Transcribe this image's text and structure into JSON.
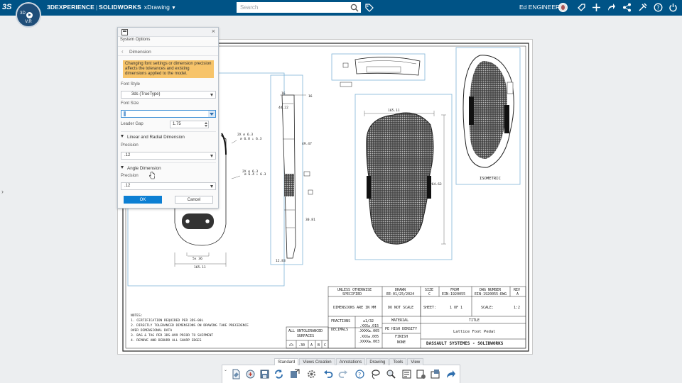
{
  "topbar": {
    "compass_quadrants": [
      "3D",
      "V.R"
    ],
    "logo": "3S",
    "brand_bold": "3DEXPERIENCE",
    "separator": "|",
    "brand_product": "SOLIDWORKS",
    "app_name": "xDrawing",
    "search_placeholder": "Search",
    "user_name": "Ed ENGINEER",
    "icons": [
      "compass-icon",
      "search-icon",
      "tag-icon",
      "avatar",
      "share-icon",
      "add-icon",
      "send-icon",
      "network-icon",
      "tools-icon",
      "help-icon",
      "power-icon"
    ]
  },
  "options_panel": {
    "title": "System Options",
    "section": "Dimension",
    "warning": "Changing font settings or dimension precision affects the tolerances and existing dimensions applied to the model.",
    "font_style_label": "Font Style",
    "font_style_value": "3ds (TrueType)",
    "font_size_label": "Font Size",
    "font_size_value": "",
    "leader_gap_label": "Leader Gap",
    "leader_gap_value": "1.75",
    "linear_group": "Linear and Radial Dimension",
    "linear_precision_label": "Precision",
    "linear_precision_value": ".12",
    "angle_group": "Angle Dimension",
    "angle_precision_label": "Precision",
    "angle_precision_value": ".12",
    "ok_label": "OK",
    "cancel_label": "Cancel"
  },
  "drawing": {
    "dims": {
      "width_top": "165.11",
      "height_right": "264.63",
      "side_top": "16",
      "side_a": "44.22",
      "side_b": "49.47",
      "side_c": "30.81",
      "side_bottom": "12.83",
      "front_1": "5x 36",
      "front_2": "165.11",
      "callout_a": "2X ⌀ 6.3",
      "callout_b": "2X ⌀ 6.3",
      "callout_c": "⌀ 6.8 ↓ 6.3",
      "callout_d": "⌀ 6.4 ↓ 6.3"
    },
    "view_label_iso": "ISOMETRIC",
    "notes_title": "NOTES:",
    "notes": [
      "1. CERTIFICATION REQUIRED PER 3DS-00L",
      "2. DIRECTLY TOLERANCED DIMENSIONS ON DRAWING TAKE PRECEDENCE",
      "   OVER DIMENSIONAL DATA",
      "3. BAG & TAG PER 3DS-099 PRIOR TO SHIPMENT",
      "4. REMOVE AND DEBURR ALL SHARP EDGES"
    ],
    "title_block": {
      "unless": "UNLESS OTHERWISE",
      "specified": "SPECIFIED",
      "drawn_label": "DRAWN",
      "drawn_value": "EE-01/25/2024",
      "size_label": "SIZE",
      "size_value": "C",
      "from_label": "FROM",
      "from_value": "EIN-1920055",
      "dwg_label": "DWG NUMBER",
      "dwg_value": "EIN-1920055-DWG",
      "rev_label": "REV",
      "rev_value": "A",
      "dims_in": "DIMENSIONS ARE IN MM",
      "no_scale": "DO NOT SCALE",
      "sheet": "SHEET:",
      "sheet_value": "1 OF 1",
      "scale": "SCALE:",
      "scale_value": "1:2",
      "fractions": "FRACTIONS",
      "fractions_value": "±1/32",
      "decimals": "DECIMALS",
      "decimals_v1": ".XXX±.015",
      "decimals_v2": ".XXXX±.005",
      "decimals_v3": ".XXX±.005",
      "decimals_v4": ".XXXX±.003",
      "material_label": "MATERIAL",
      "material_value": "PE HIGH DENSITY",
      "finish_label": "FINISH",
      "finish_value": "NONE",
      "title_label": "TITLE",
      "title_value": "Lattice Foot Pedal",
      "all_untol": "ALL UNTOLERANCED",
      "surfaces": "SURFACES",
      "untol_cells": [
        ".30",
        "A",
        "B",
        "C"
      ],
      "company": "DASSAULT SYSTEMES - SOLIDWORKS"
    }
  },
  "bottom_tabs": [
    {
      "label": "Standard",
      "active": true
    },
    {
      "label": "Views Creation",
      "active": false
    },
    {
      "label": "Annotations",
      "active": false
    },
    {
      "label": "Drawing",
      "active": false
    },
    {
      "label": "Tools",
      "active": false
    },
    {
      "label": "View",
      "active": false
    }
  ],
  "toolbar_icons": [
    "new-doc-icon",
    "open-icon",
    "save-icon",
    "rebuild-icon",
    "save-as-icon",
    "settings-icon",
    "undo-icon",
    "redo-icon",
    "help-icon",
    "lasso-icon",
    "zoom-icon",
    "sheet-properties-icon",
    "sheet-format-icon",
    "export-icon",
    "share-icon"
  ]
}
